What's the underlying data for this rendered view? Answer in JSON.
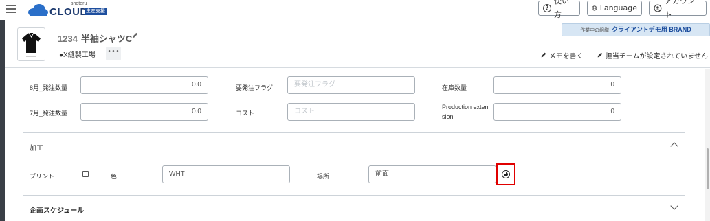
{
  "topbar": {
    "logo_small": "shoteru",
    "logo_main": "CLOUD",
    "logo_tag": "生産支援",
    "help_label": "使い方",
    "language_label": "Language",
    "account_label": "アカウント"
  },
  "item": {
    "code": "1234",
    "name": "半袖シャツC",
    "factory": "●X縫製工場",
    "more_label": "•••",
    "org_label": "作業中の組織",
    "org_value": "クライアントデモ用 BRAND",
    "memo_label": "メモを書く",
    "team_label": "担当チームが設定されていません"
  },
  "form": {
    "row1": {
      "label_a": "8月_発注数量",
      "value_a": "0.0",
      "label_b": "要発注フラグ",
      "placeholder_b": "要発注フラグ",
      "label_c": "在庫数量",
      "value_c": "0"
    },
    "row2": {
      "label_a": "7月_発注数量",
      "value_a": "0.0",
      "label_b": "コスト",
      "placeholder_b": "コスト",
      "label_c1": "Production exten",
      "label_c2": "sion",
      "value_c": "0"
    },
    "processing": {
      "title": "加工",
      "print_label": "プリント",
      "color_label": "色",
      "color_value": "WHT",
      "location_label": "場所",
      "location_value": "前面"
    },
    "schedule": {
      "title": "企画スケジュール"
    }
  },
  "icons": {
    "menu": "hamburger-icon",
    "help": "question-circle-icon",
    "language": "globe-icon",
    "account": "user-circle-icon",
    "edit": "pencil-icon",
    "picker": "color-picker-icon"
  },
  "colors": {
    "brand": "#1d3a6e",
    "highlight": "#e00000",
    "org_bg": "#d7e6f4",
    "rail": "#3a3f47"
  }
}
